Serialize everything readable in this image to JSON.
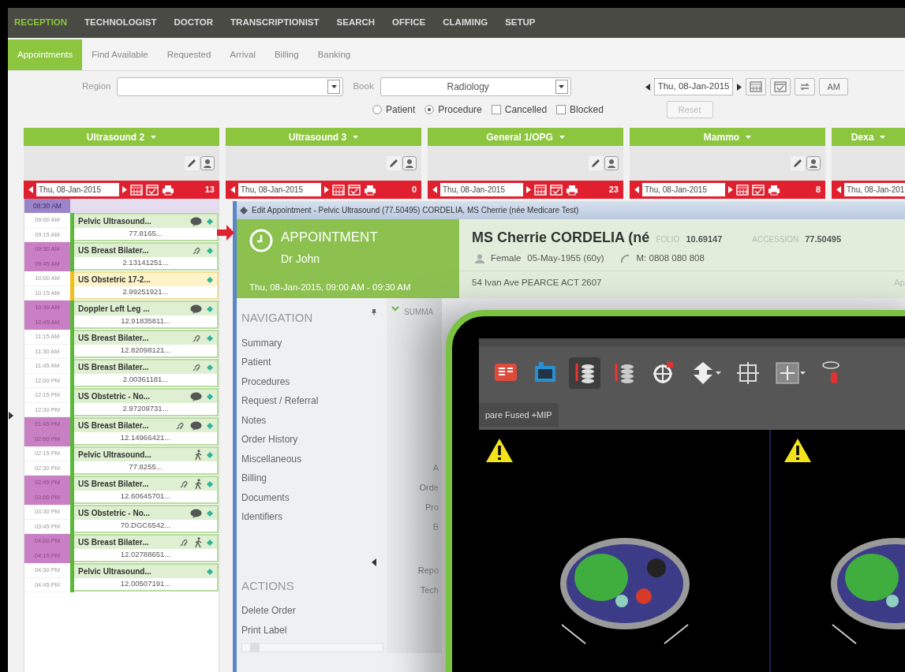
{
  "nav_menu": [
    {
      "label": "RECEPTION",
      "selected": true
    },
    {
      "label": "TECHNOLOGIST",
      "selected": false
    },
    {
      "label": "DOCTOR",
      "selected": false
    },
    {
      "label": "TRANSCRIPTIONIST",
      "selected": false
    },
    {
      "label": "SEARCH",
      "selected": false
    },
    {
      "label": "OFFICE",
      "selected": false
    },
    {
      "label": "CLAIMING",
      "selected": false
    },
    {
      "label": "SETUP",
      "selected": false
    }
  ],
  "sub_tabs": [
    {
      "label": "Appointments",
      "selected": true
    },
    {
      "label": "Find Available",
      "selected": false
    },
    {
      "label": "Requested",
      "selected": false
    },
    {
      "label": "Arrival",
      "selected": false
    },
    {
      "label": "Billing",
      "selected": false
    },
    {
      "label": "Banking",
      "selected": false
    }
  ],
  "filters": {
    "region_label": "Region",
    "book_label": "Book",
    "book_value": "Radiology",
    "date": "Thu, 08-Jan-2015",
    "ampm": "AM",
    "reset": {
      "label": "Reset",
      "disabled": true
    },
    "options": [
      {
        "kind": "radio",
        "label": "Patient",
        "checked": false
      },
      {
        "kind": "radio",
        "label": "Procedure",
        "checked": true
      },
      {
        "kind": "checkbox",
        "label": "Cancelled",
        "checked": false
      },
      {
        "kind": "checkbox",
        "label": "Blocked",
        "checked": false
      }
    ]
  },
  "resources": [
    {
      "name": "Ultrasound 2",
      "date": "Thu, 08-Jan-2015",
      "count": "13"
    },
    {
      "name": "Ultrasound 3",
      "date": "Thu, 08-Jan-2015",
      "count": "0"
    },
    {
      "name": "General 1/OPG",
      "date": "Thu, 08-Jan-2015",
      "count": "23"
    },
    {
      "name": "Mammo",
      "date": "Thu, 08-Jan-2015",
      "count": "8"
    },
    {
      "name": "Dexa",
      "date": "Thu, 08-Jan-201"
    }
  ],
  "schedule": {
    "blocked_slot": "08:30 AM",
    "appointments": [
      {
        "start": "09:00 AM",
        "end": "09:15 AM",
        "title": "Pelvic Ultrasound...",
        "number": "77.8165...",
        "linked": false,
        "commented": true,
        "walk_in": false,
        "highlight": false,
        "color": "#5cb83a"
      },
      {
        "start": "09:30 AM",
        "end": "09:45 AM",
        "title": "US Breast Bilater...",
        "number": "2.13141251...",
        "linked": true,
        "commented": false,
        "walk_in": false,
        "highlight": true,
        "color": "#5cb83a"
      },
      {
        "start": "10:00 AM",
        "end": "10:15 AM",
        "title": "US Obstetric 17-2...",
        "number": "2.99251921...",
        "linked": false,
        "commented": false,
        "walk_in": false,
        "highlight": false,
        "color": "#f2bf1a"
      },
      {
        "start": "10:30 AM",
        "end": "10:45 AM",
        "title": "Doppler Left Leg ...",
        "number": "12.91835811...",
        "linked": false,
        "commented": true,
        "walk_in": false,
        "highlight": true,
        "color": "#5cb83a"
      },
      {
        "start": "11:15 AM",
        "end": "11:30 AM",
        "title": "US Breast Bilater...",
        "number": "12.82098121...",
        "linked": true,
        "commented": false,
        "walk_in": false,
        "highlight": false,
        "color": "#5cb83a"
      },
      {
        "start": "11:45 AM",
        "end": "12:00 PM",
        "title": "US Breast Bilater...",
        "number": "2.00361181...",
        "linked": true,
        "commented": false,
        "walk_in": false,
        "highlight": false,
        "color": "#5cb83a"
      },
      {
        "start": "12:15 PM",
        "end": "12:30 PM",
        "title": "US Obstetric - No...",
        "number": "2.97209731...",
        "linked": false,
        "commented": true,
        "walk_in": false,
        "highlight": false,
        "color": "#5cb83a"
      },
      {
        "start": "01:45 PM",
        "end": "02:00 PM",
        "title": "US Breast Bilater...",
        "number": "12.14966421...",
        "linked": true,
        "commented": true,
        "walk_in": false,
        "highlight": true,
        "color": "#5cb83a"
      },
      {
        "start": "02:15 PM",
        "end": "02:30 PM",
        "title": "Pelvic Ultrasound...",
        "number": "77.8255...",
        "linked": false,
        "commented": false,
        "walk_in": true,
        "highlight": false,
        "color": "#5cb83a"
      },
      {
        "start": "02:45 PM",
        "end": "03:00 PM",
        "title": "US Breast Bilater...",
        "number": "12.60645701...",
        "linked": true,
        "commented": false,
        "walk_in": true,
        "highlight": true,
        "color": "#5cb83a"
      },
      {
        "start": "03:30 PM",
        "end": "03:45 PM",
        "title": "US Obstetric - No...",
        "number": "70.DGC6542...",
        "linked": false,
        "commented": true,
        "walk_in": false,
        "highlight": false,
        "color": "#5cb83a"
      },
      {
        "start": "04:00 PM",
        "end": "04:15 PM",
        "title": "US Breast Bilater...",
        "number": "12.02788651...",
        "linked": true,
        "commented": false,
        "walk_in": true,
        "highlight": true,
        "color": "#5cb83a"
      },
      {
        "start": "04:30 PM",
        "end": "04:45 PM",
        "title": "Pelvic Ultrasound...",
        "number": "12.00507191...",
        "linked": false,
        "commented": false,
        "walk_in": false,
        "highlight": false,
        "color": "#5cb83a"
      }
    ]
  },
  "dialog": {
    "title": "Edit Appointment - Pelvic Ultrasound (77.50495) CORDELIA, MS Cherrie (née Medicare Test)",
    "heading": "APPOINTMENT",
    "doctor": "Dr John",
    "when": "Thu, 08-Jan-2015, 09:00 AM - 09:30 AM",
    "patient_name": "MS Cherrie CORDELIA (né",
    "folio_label": "FOLIO",
    "folio": "10.69147",
    "accession_label": "ACCESSION",
    "accession": "77.50495",
    "sex": "Female",
    "dob": "05-May-1955 (60y)",
    "phone": "M: 0808 080 808",
    "address": "54 Ivan Ave PEARCE ACT 2607",
    "address_right": "Ap",
    "navigation_title": "NAVIGATION",
    "navigation": [
      "Summary",
      "Patient",
      "Procedures",
      "Request / Referral",
      "Notes",
      "Order History",
      "Miscellaneous",
      "Billing",
      "Documents",
      "Identifiers"
    ],
    "actions_title": "ACTIONS",
    "actions": [
      "Delete Order",
      "Print Label"
    ],
    "summary_title": "SUMMA",
    "summary_labels": [
      "A",
      "Orde",
      "Pro",
      "B"
    ],
    "summary_labels_lower": [
      "Repo",
      "Tech"
    ]
  },
  "viewer": {
    "tab": "pare Fused +MIP",
    "tools": [
      {
        "kind": "report",
        "selected": false
      },
      {
        "kind": "monitor",
        "selected": false
      },
      {
        "kind": "stack-up",
        "selected": true
      },
      {
        "kind": "stack-down",
        "selected": false
      },
      {
        "kind": "target",
        "selected": false
      },
      {
        "kind": "arrow",
        "selected": false,
        "menu": true
      },
      {
        "kind": "grid",
        "selected": false
      },
      {
        "kind": "expand",
        "selected": false,
        "menu": true
      },
      {
        "kind": "ellipse",
        "selected": false
      }
    ]
  }
}
